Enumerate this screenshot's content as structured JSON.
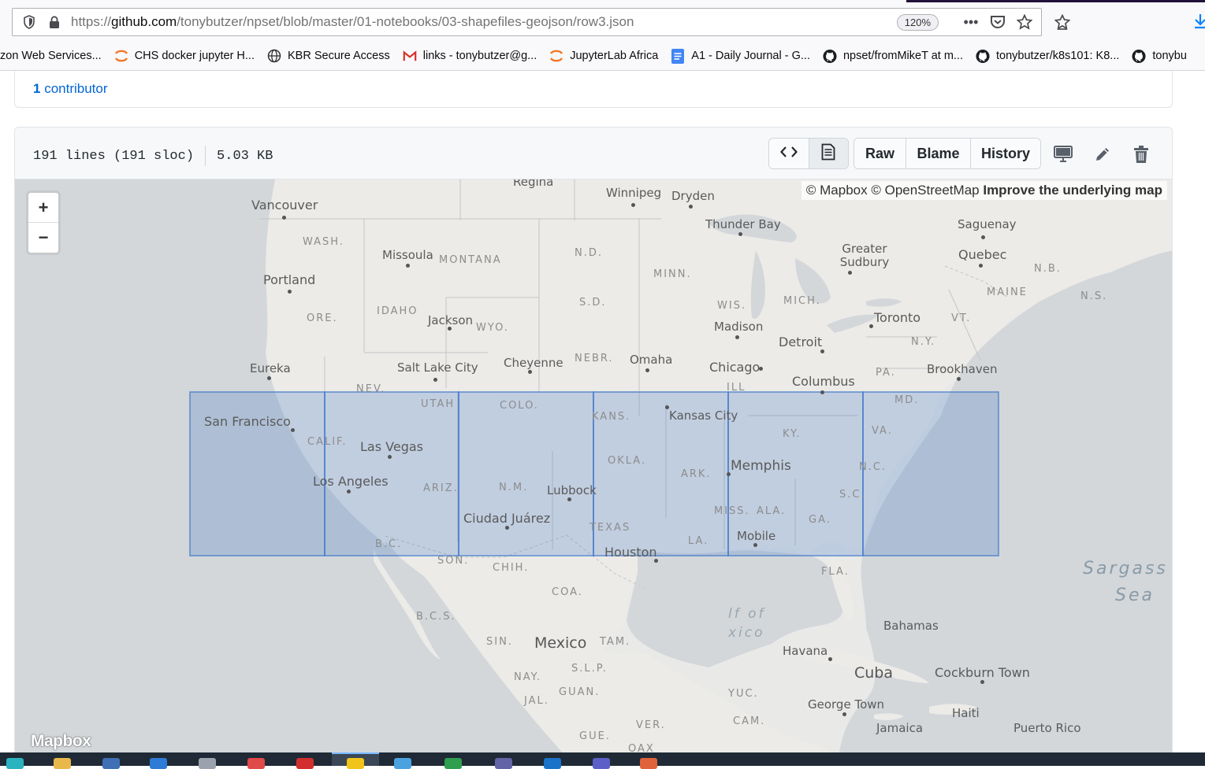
{
  "browser": {
    "url_prefix": "https://",
    "url_host": "github.com",
    "url_path": "/tonybutzer/npset/blob/master/01-notebooks/03-shapefiles-geojson/row3.json",
    "zoom": "120%",
    "bookmarks": [
      {
        "label": "zon Web Services...",
        "icon": "none"
      },
      {
        "label": "CHS docker jupyter H...",
        "icon": "jupyter-icon"
      },
      {
        "label": "KBR Secure Access",
        "icon": "globe-icon"
      },
      {
        "label": "links - tonybutzer@g...",
        "icon": "gmail-icon"
      },
      {
        "label": "JupyterLab Africa",
        "icon": "jupyter-icon"
      },
      {
        "label": "A1 - Daily Journal - G...",
        "icon": "docs-icon"
      },
      {
        "label": "npset/fromMikeT at m...",
        "icon": "github-icon"
      },
      {
        "label": "tonybutzer/k8s101: K8...",
        "icon": "github-icon"
      },
      {
        "label": "tonybu",
        "icon": "github-icon"
      }
    ]
  },
  "repo": {
    "contributor_count": "1",
    "contributor_label": "contributor"
  },
  "file": {
    "lines": "191 lines (191 sloc)",
    "size": "5.03 KB",
    "buttons": {
      "raw": "Raw",
      "blame": "Blame",
      "history": "History"
    }
  },
  "map": {
    "zoom_in": "+",
    "zoom_out": "−",
    "attribution_prefix": "© Mapbox © OpenStreetMap",
    "attribution_link": "Improve the underlying map",
    "logo": "Mapbox",
    "fill_color": "#3f78c9",
    "labels": {
      "regina": "Regina",
      "winnipeg": "Winnipeg",
      "dryden": "Dryden",
      "vancouver": "Vancouver",
      "thunder_bay": "Thunder Bay",
      "saguenay": "Saguenay",
      "wash": "WASH.",
      "missoula": "Missoula",
      "montana": "MONTANA",
      "nd": "N.D.",
      "greater_sudbury": "Greater Sudbury",
      "quebec": "Quebec",
      "nb": "N.B.",
      "portland": "Portland",
      "minn": "MINN.",
      "maine": "MAINE",
      "ns": "N.S.",
      "sd": "S.D.",
      "wis": "WIS.",
      "mich": "MICH.",
      "idaho": "IDAHO",
      "ore": "ORE.",
      "jackson": "Jackson",
      "wyo": "WYO.",
      "madison": "Madison",
      "toronto": "Toronto",
      "vt": "VT.",
      "detroit": "Detroit",
      "ny": "N.Y.",
      "eureka": "Eureka",
      "salt_lake_city": "Salt Lake City",
      "cheyenne": "Cheyenne",
      "nebr": "NEBR.",
      "omaha": "Omaha",
      "chicago": "Chicago",
      "brookhaven": "Brookhaven",
      "pa": "PA.",
      "columbus": "Columbus",
      "nev": "NEV.",
      "ill": "ILL",
      "utah": "UTAH",
      "colo": "COLO.",
      "md": "MD.",
      "san_francisco": "San Francisco",
      "kans": "KANS.",
      "kansas_city": "Kansas City",
      "calif": "CALIF.",
      "las_vegas": "Las Vegas",
      "ky": "KY.",
      "va": "VA.",
      "okla": "OKLA.",
      "memphis": "Memphis",
      "los_angeles": "Los Angeles",
      "ark": "ARK.",
      "nc": "N.C.",
      "ariz": "ARIZ.",
      "nm": "N.M.",
      "lubbock": "Lubbock",
      "sc": "S.C.",
      "miss": "MISS.",
      "ala": "ALA.",
      "ciudad_juarez": "Ciudad Juárez",
      "ga": "GA.",
      "texas": "TEXAS",
      "mobile": "Mobile",
      "la": "LA.",
      "bc": "B.C.",
      "houston": "Houston",
      "son": "SON.",
      "chih": "CHIH.",
      "fla": "FLA.",
      "sargasso_sea_1": "Sargass",
      "sargasso_sea_2": "Sea",
      "coa": "COA.",
      "gulf_1": "lf of",
      "gulf_2": "xico",
      "bcs": "B.C.S.",
      "bahamas": "Bahamas",
      "sin": "SIN.",
      "mexico": "Mexico",
      "tam": "TAM.",
      "havana": "Havana",
      "slp": "S.L.P.",
      "cuba": "Cuba",
      "cockburn_town": "Cockburn Town",
      "nay": "NAY.",
      "guan": "GUAN.",
      "yuc": "YUC.",
      "jal": "JAL.",
      "george_town": "George Town",
      "haiti": "Haiti",
      "cam": "CAM.",
      "ver": "VER.",
      "jamaica": "Jamaica",
      "puerto_rico": "Puerto Rico",
      "gue": "GUE.",
      "oax": "OAX"
    }
  }
}
